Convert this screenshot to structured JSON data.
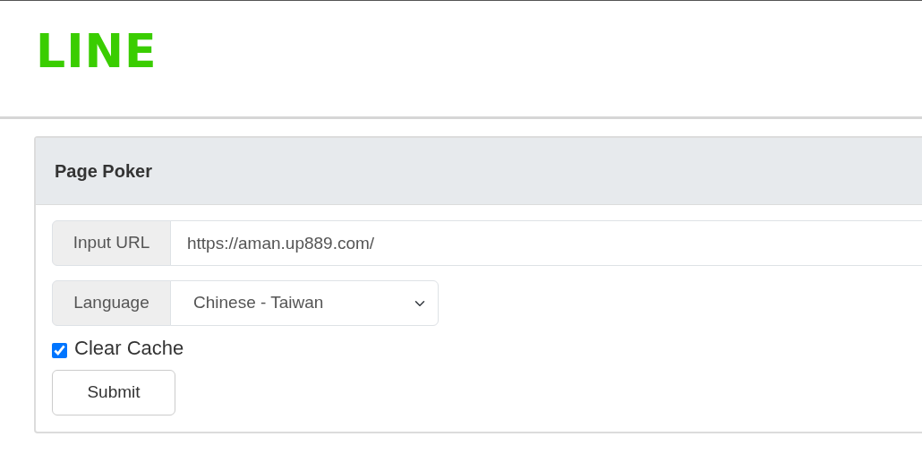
{
  "logo": "LINE",
  "card": {
    "title": "Page Poker"
  },
  "url_field": {
    "label": "Input URL",
    "value": "https://aman.up889.com/"
  },
  "language_field": {
    "label": "Language",
    "value": "Chinese - Taiwan"
  },
  "clear_cache": {
    "label": "Clear Cache",
    "checked": true
  },
  "buttons": [
    "Submit"
  ]
}
